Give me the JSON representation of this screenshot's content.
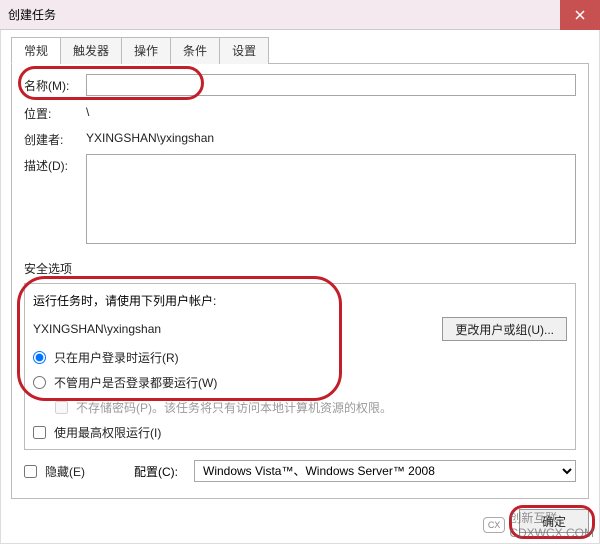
{
  "title": "创建任务",
  "tabs": [
    "常规",
    "触发器",
    "操作",
    "条件",
    "设置"
  ],
  "labels": {
    "name": "名称(M):",
    "location": "位置:",
    "author": "创建者:",
    "description": "描述(D):",
    "securityOptions": "安全选项",
    "accountLine1": "运行任务时，请使用下列用户帐户:",
    "changeUserBtn": "更改用户或组(U)...",
    "radio1": "只在用户登录时运行(R)",
    "radio2": "不管用户是否登录都要运行(W)",
    "savePwNote": "不存储密码(P)。该任务将只有访问本地计算机资源的权限。",
    "highestPriv": "使用最高权限运行(I)",
    "hidden": "隐藏(E)",
    "configure": "配置(C):",
    "ok": "确定"
  },
  "values": {
    "name": "",
    "location": "\\",
    "author": "YXINGSHAN\\yxingshan",
    "description": "",
    "account": "YXINGSHAN\\yxingshan",
    "configure": "Windows Vista™、Windows Server™ 2008",
    "savePwChecked": false,
    "highestPrivChecked": false,
    "hiddenChecked": false
  },
  "watermark": {
    "icon": "CX",
    "text": "创新互联",
    "sub": "CDXWCX.COM"
  }
}
